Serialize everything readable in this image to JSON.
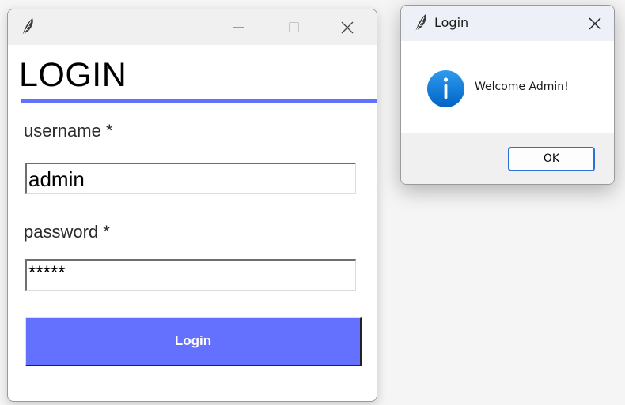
{
  "login_window": {
    "title": "",
    "app_icon": "feather-icon",
    "heading": "LOGIN",
    "accent_color": "#6471ff",
    "username_label": "username *",
    "username_value": "admin",
    "password_label": "password *",
    "password_value": "*****",
    "login_button_label": "Login",
    "window_controls": [
      "minimize-icon",
      "maximize-icon",
      "close-icon"
    ]
  },
  "message_dialog": {
    "title": "Login",
    "app_icon": "feather-icon",
    "icon": "info-icon",
    "icon_color": "#0a78d4",
    "message": "Welcome Admin!",
    "ok_button_label": "OK",
    "ok_button_border_color": "#2a72d6"
  }
}
